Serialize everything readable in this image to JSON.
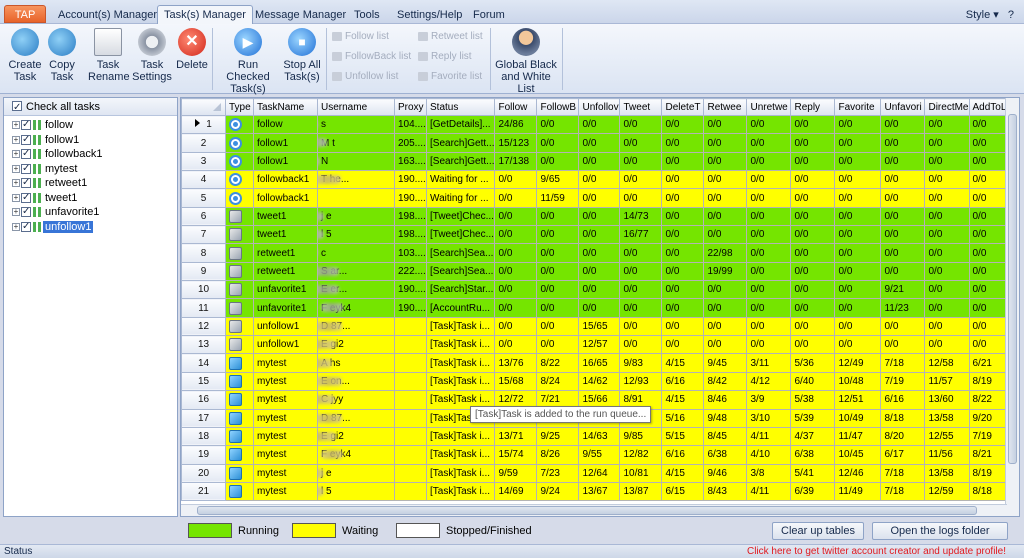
{
  "menubar": {
    "app_tab": "TAP",
    "tabs": [
      "Account(s) Manager",
      "Task(s) Manager",
      "Message Manager",
      "Tools",
      "Settings/Help",
      "Forum"
    ],
    "style": "Style"
  },
  "ribbon": {
    "create_task": "Create Task",
    "copy_task": "Copy Task",
    "task_rename": "Task Rename",
    "task_settings": "Task Settings",
    "delete": "Delete",
    "run_checked": "Run Checked Task(s)",
    "stop_all": "Stop All Task(s)",
    "follow_list": "Follow list",
    "followback_list": "FollowBack list",
    "unfollow_list": "Unfollow list",
    "retweet_list": "Retweet list",
    "reply_list": "Reply list",
    "favorite_list": "Favorite list",
    "global_list": "Global Black and White List"
  },
  "tree": {
    "check_all": "Check all tasks",
    "items": [
      {
        "label": "follow"
      },
      {
        "label": "follow1"
      },
      {
        "label": "followback1"
      },
      {
        "label": "mytest"
      },
      {
        "label": "retweet1"
      },
      {
        "label": "tweet1"
      },
      {
        "label": "unfavorite1"
      },
      {
        "label": "unfollow1",
        "selected": true
      }
    ]
  },
  "grid": {
    "columns": [
      "Type",
      "TaskName",
      "Username",
      "Proxy",
      "Status",
      "Follow",
      "FollowB",
      "Unfollov",
      "Tweet",
      "DeleteT",
      "Retwee",
      "Unretwe",
      "Reply",
      "Favorite",
      "Unfavori",
      "DirectMe",
      "AddToL"
    ],
    "rows": [
      {
        "n": "1",
        "type": "follow",
        "color": "green",
        "task": "follow",
        "user": "s",
        "proxy": "104....",
        "status": "[GetDetails]...",
        "vals": [
          "24/86",
          "0/0",
          "0/0",
          "0/0",
          "0/0",
          "0/0",
          "0/0",
          "0/0",
          "0/0",
          "0/0",
          "0/0",
          "0/0"
        ]
      },
      {
        "n": "2",
        "type": "follow",
        "color": "green",
        "task": "follow1",
        "user": "M                t",
        "proxy": "205....",
        "status": "[Search]Gett...",
        "vals": [
          "15/123",
          "0/0",
          "0/0",
          "0/0",
          "0/0",
          "0/0",
          "0/0",
          "0/0",
          "0/0",
          "0/0",
          "0/0",
          "0/0"
        ]
      },
      {
        "n": "3",
        "type": "follow",
        "color": "green",
        "task": "follow1",
        "user": "N",
        "proxy": "163....",
        "status": "[Search]Gett...",
        "vals": [
          "17/138",
          "0/0",
          "0/0",
          "0/0",
          "0/0",
          "0/0",
          "0/0",
          "0/0",
          "0/0",
          "0/0",
          "0/0",
          "0/0"
        ]
      },
      {
        "n": "4",
        "type": "follow",
        "color": "yellow",
        "task": "followback1",
        "user": "T               he...",
        "proxy": "190....",
        "status": "Waiting for ...",
        "vals": [
          "0/0",
          "9/65",
          "0/0",
          "0/0",
          "0/0",
          "0/0",
          "0/0",
          "0/0",
          "0/0",
          "0/0",
          "0/0",
          "0/0"
        ]
      },
      {
        "n": "5",
        "type": "follow",
        "color": "yellow",
        "task": "followback1",
        "user": "",
        "proxy": "190....",
        "status": "Waiting for ...",
        "vals": [
          "0/0",
          "11/59",
          "0/0",
          "0/0",
          "0/0",
          "0/0",
          "0/0",
          "0/0",
          "0/0",
          "0/0",
          "0/0",
          "0/0"
        ]
      },
      {
        "n": "6",
        "type": "tweet",
        "color": "green",
        "task": "tweet1",
        "user": "j               e",
        "proxy": "198....",
        "status": "[Tweet]Chec...",
        "vals": [
          "0/0",
          "0/0",
          "0/0",
          "14/73",
          "0/0",
          "0/0",
          "0/0",
          "0/0",
          "0/0",
          "0/0",
          "0/0",
          "0/0"
        ]
      },
      {
        "n": "7",
        "type": "tweet",
        "color": "green",
        "task": "tweet1",
        "user": "l                5",
        "proxy": "198....",
        "status": "[Tweet]Chec...",
        "vals": [
          "0/0",
          "0/0",
          "0/0",
          "16/77",
          "0/0",
          "0/0",
          "0/0",
          "0/0",
          "0/0",
          "0/0",
          "0/0",
          "0/0"
        ]
      },
      {
        "n": "8",
        "type": "tweet",
        "color": "green",
        "task": "retweet1",
        "user": "c",
        "proxy": "103....",
        "status": "[Search]Sea...",
        "vals": [
          "0/0",
          "0/0",
          "0/0",
          "0/0",
          "0/0",
          "22/98",
          "0/0",
          "0/0",
          "0/0",
          "0/0",
          "0/0",
          "0/0"
        ]
      },
      {
        "n": "9",
        "type": "tweet",
        "color": "green",
        "task": "retweet1",
        "user": "S               ar...",
        "proxy": "222....",
        "status": "[Search]Sea...",
        "vals": [
          "0/0",
          "0/0",
          "0/0",
          "0/0",
          "0/0",
          "19/99",
          "0/0",
          "0/0",
          "0/0",
          "0/0",
          "0/0",
          "0/0"
        ]
      },
      {
        "n": "10",
        "type": "tweet",
        "color": "green",
        "task": "unfavorite1",
        "user": "E               er...",
        "proxy": "190....",
        "status": "[Search]Star...",
        "vals": [
          "0/0",
          "0/0",
          "0/0",
          "0/0",
          "0/0",
          "0/0",
          "0/0",
          "0/0",
          "0/0",
          "9/21",
          "0/0",
          "0/0"
        ]
      },
      {
        "n": "11",
        "type": "tweet",
        "color": "green",
        "task": "unfavorite1",
        "user": "F               eyk4",
        "proxy": "190....",
        "status": "[AccountRu...",
        "vals": [
          "0/0",
          "0/0",
          "0/0",
          "0/0",
          "0/0",
          "0/0",
          "0/0",
          "0/0",
          "0/0",
          "11/23",
          "0/0",
          "0/0"
        ]
      },
      {
        "n": "12",
        "type": "tweet",
        "color": "yellow",
        "task": "unfollow1",
        "user": "D               87...",
        "proxy": "",
        "status": "[Task]Task i...",
        "vals": [
          "0/0",
          "0/0",
          "15/65",
          "0/0",
          "0/0",
          "0/0",
          "0/0",
          "0/0",
          "0/0",
          "0/0",
          "0/0",
          "0/0"
        ]
      },
      {
        "n": "13",
        "type": "tweet",
        "color": "yellow",
        "task": "unfollow1",
        "user": "E               gi2",
        "proxy": "",
        "status": "[Task]Task i...",
        "vals": [
          "0/0",
          "0/0",
          "12/57",
          "0/0",
          "0/0",
          "0/0",
          "0/0",
          "0/0",
          "0/0",
          "0/0",
          "0/0",
          "0/0"
        ]
      },
      {
        "n": "14",
        "type": "mytest",
        "color": "yellow",
        "task": "mytest",
        "user": "A               hs",
        "proxy": "",
        "status": "[Task]Task i...",
        "vals": [
          "13/76",
          "8/22",
          "16/65",
          "9/83",
          "4/15",
          "9/45",
          "3/11",
          "5/36",
          "12/49",
          "7/18",
          "12/58",
          "6/21"
        ]
      },
      {
        "n": "15",
        "type": "mytest",
        "color": "yellow",
        "task": "mytest",
        "user": "E               on...",
        "proxy": "",
        "status": "[Task]Task i...",
        "vals": [
          "15/68",
          "8/24",
          "14/62",
          "12/93",
          "6/16",
          "8/42",
          "4/12",
          "6/40",
          "10/48",
          "7/19",
          "11/57",
          "8/19"
        ]
      },
      {
        "n": "16",
        "type": "mytest",
        "color": "yellow",
        "task": "mytest",
        "user": "C               jyy",
        "proxy": "",
        "status": "[Task]Task i...",
        "vals": [
          "12/72",
          "7/21",
          "15/66",
          "8/91",
          "4/15",
          "8/46",
          "3/9",
          "5/38",
          "12/51",
          "6/16",
          "13/60",
          "8/22"
        ]
      },
      {
        "n": "17",
        "type": "mytest",
        "color": "yellow",
        "task": "mytest",
        "user": "D               87...",
        "proxy": "",
        "status": "[Task]Task i...",
        "vals": [
          "",
          "",
          "",
          "",
          "5/16",
          "9/48",
          "3/10",
          "5/39",
          "10/49",
          "8/18",
          "13/58",
          "9/20"
        ]
      },
      {
        "n": "18",
        "type": "mytest",
        "color": "yellow",
        "task": "mytest",
        "user": "E               gi2",
        "proxy": "",
        "status": "[Task]Task i...",
        "vals": [
          "13/71",
          "9/25",
          "14/63",
          "9/85",
          "5/15",
          "8/45",
          "4/11",
          "4/37",
          "11/47",
          "8/20",
          "12/55",
          "7/19"
        ]
      },
      {
        "n": "19",
        "type": "mytest",
        "color": "yellow",
        "task": "mytest",
        "user": "F               eyk4",
        "proxy": "",
        "status": "[Task]Task i...",
        "vals": [
          "15/74",
          "8/26",
          "9/55",
          "12/82",
          "6/16",
          "6/38",
          "4/10",
          "6/38",
          "10/45",
          "6/17",
          "11/56",
          "8/21"
        ]
      },
      {
        "n": "20",
        "type": "mytest",
        "color": "yellow",
        "task": "mytest",
        "user": "j               e",
        "proxy": "",
        "status": "[Task]Task i...",
        "vals": [
          "9/59",
          "7/23",
          "12/64",
          "10/81",
          "4/15",
          "9/46",
          "3/8",
          "5/41",
          "12/46",
          "7/18",
          "13/58",
          "8/19"
        ]
      },
      {
        "n": "21",
        "type": "mytest",
        "color": "yellow",
        "task": "mytest",
        "user": "l                5",
        "proxy": "",
        "status": "[Task]Task i...",
        "vals": [
          "14/69",
          "9/24",
          "13/67",
          "13/87",
          "6/15",
          "8/43",
          "4/11",
          "6/39",
          "11/49",
          "7/18",
          "12/59",
          "8/18"
        ]
      }
    ],
    "tooltip": "[Task]Task is added to the run queue..."
  },
  "legend": {
    "running": "Running",
    "waiting": "Waiting",
    "stopped": "Stopped/Finished",
    "clear_button": "Clear up tables",
    "logs_button": "Open the logs folder"
  },
  "statusbar": {
    "status": "Status",
    "promo": "Click here to get twitter account creator and update profile!"
  },
  "colors": {
    "running": "#75e500",
    "waiting": "#ffff00",
    "stopped": "#ffffff",
    "accent": "#e8632a"
  }
}
